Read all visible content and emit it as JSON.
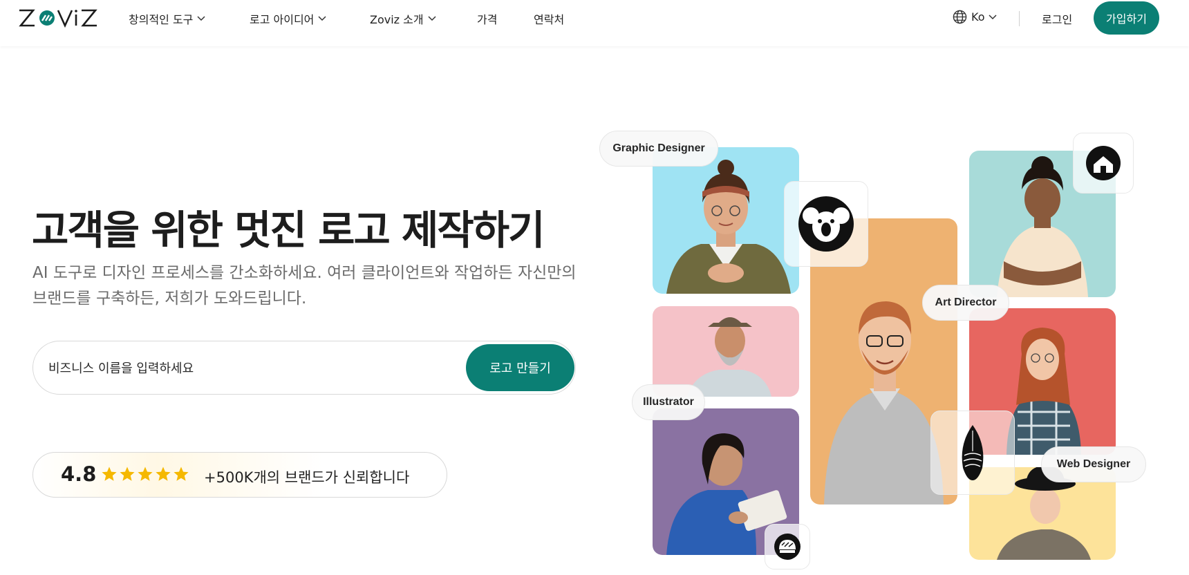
{
  "header": {
    "brand": "ZOVIZ",
    "nav": [
      {
        "label": "창의적인 도구",
        "dropdown": true
      },
      {
        "label": "로고 아이디어",
        "dropdown": true
      },
      {
        "label": "Zoviz 소개",
        "dropdown": true
      },
      {
        "label": "가격",
        "dropdown": false
      },
      {
        "label": "연락처",
        "dropdown": false
      }
    ],
    "language": "Ko",
    "login_label": "로그인",
    "signup_label": "가입하기"
  },
  "hero": {
    "title": "고객을 위한 멋진 로고 제작하기",
    "subtitle": "AI 도구로 디자인 프로세스를 간소화하세요. 여러 클라이언트와 작업하든 자신만의 브랜드를 구축하든, 저희가 도와드립니다.",
    "search_placeholder": "비즈니스 이름을 입력하세요",
    "cta_label": "로고 만들기",
    "rating": "4.8",
    "stars": 5,
    "trust_text": "+500K개의 브랜드가 신뢰합니다"
  },
  "collage": {
    "labels": {
      "graphic_designer": "Graphic Designer",
      "art_director": "Art Director",
      "illustrator": "Illustrator",
      "web_designer": "Web Designer"
    },
    "logo_icons": [
      "koala-logo-icon",
      "house-logo-icon",
      "surfboard-logo-icon",
      "bread-logo-icon"
    ]
  },
  "colors": {
    "brand": "#0b7f74",
    "star": "#f5b800",
    "card_cyan": "#9fe3f3",
    "card_pink": "#f5c2c8",
    "card_purple": "#8a72a2",
    "card_orange": "#eeb271",
    "card_teal": "#a8dbd9",
    "card_red": "#e76660",
    "card_yellow": "#fde39a"
  }
}
